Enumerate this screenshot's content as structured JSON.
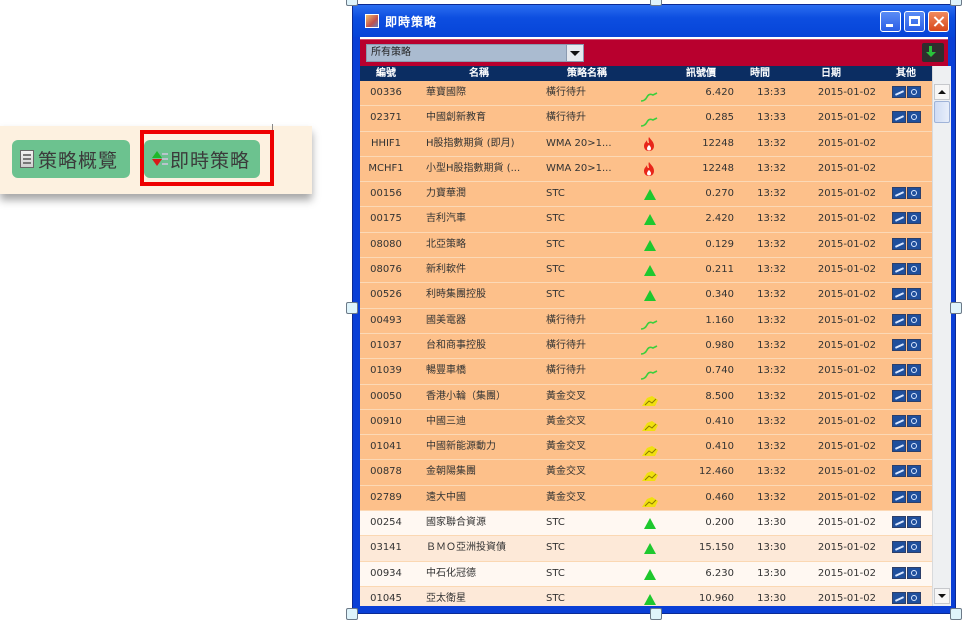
{
  "toolbar": {
    "overview_label": "策略概覽",
    "realtime_label": "即時策略"
  },
  "window": {
    "title": "即時策略",
    "controls": [
      "minimize",
      "maximize",
      "close"
    ]
  },
  "filter": {
    "selected": "所有策略",
    "export_icon": "export-icon"
  },
  "table": {
    "columns": [
      "編號",
      "名稱",
      "策略名稱",
      "",
      "訊號價",
      "時間",
      "日期",
      "其他"
    ],
    "rows": [
      {
        "code": "00336",
        "name": "華寶國際",
        "strategy": "橫行待升",
        "signal": "trend",
        "price": "6.420",
        "time": "13:33",
        "date": "2015-01-02",
        "actions": true,
        "highlight": true
      },
      {
        "code": "02371",
        "name": "中國創新教育",
        "strategy": "橫行待升",
        "signal": "trend",
        "price": "0.285",
        "time": "13:33",
        "date": "2015-01-02",
        "actions": true,
        "highlight": true
      },
      {
        "code": "HHIF1",
        "name": "H股指數期貨 (即月)",
        "strategy": "WMA 20>1...",
        "signal": "fire",
        "price": "12248",
        "time": "13:32",
        "date": "2015-01-02",
        "actions": false,
        "highlight": true
      },
      {
        "code": "MCHF1",
        "name": "小型H股指數期貨 (...",
        "strategy": "WMA 20>1...",
        "signal": "fire",
        "price": "12248",
        "time": "13:32",
        "date": "2015-01-02",
        "actions": false,
        "highlight": true
      },
      {
        "code": "00156",
        "name": "力寶華潤",
        "strategy": "STC",
        "signal": "up",
        "price": "0.270",
        "time": "13:32",
        "date": "2015-01-02",
        "actions": true,
        "highlight": true
      },
      {
        "code": "00175",
        "name": "吉利汽車",
        "strategy": "STC",
        "signal": "up",
        "price": "2.420",
        "time": "13:32",
        "date": "2015-01-02",
        "actions": true,
        "highlight": true
      },
      {
        "code": "08080",
        "name": "北亞策略",
        "strategy": "STC",
        "signal": "up",
        "price": "0.129",
        "time": "13:32",
        "date": "2015-01-02",
        "actions": true,
        "highlight": true
      },
      {
        "code": "08076",
        "name": "新利軟件",
        "strategy": "STC",
        "signal": "up",
        "price": "0.211",
        "time": "13:32",
        "date": "2015-01-02",
        "actions": true,
        "highlight": true
      },
      {
        "code": "00526",
        "name": "利時集團控股",
        "strategy": "STC",
        "signal": "up",
        "price": "0.340",
        "time": "13:32",
        "date": "2015-01-02",
        "actions": true,
        "highlight": true
      },
      {
        "code": "00493",
        "name": "國美電器",
        "strategy": "橫行待升",
        "signal": "trend",
        "price": "1.160",
        "time": "13:32",
        "date": "2015-01-02",
        "actions": true,
        "highlight": true
      },
      {
        "code": "01037",
        "name": "台和商事控股",
        "strategy": "橫行待升",
        "signal": "trend",
        "price": "0.980",
        "time": "13:32",
        "date": "2015-01-02",
        "actions": true,
        "highlight": true
      },
      {
        "code": "01039",
        "name": "暢豐車橋",
        "strategy": "橫行待升",
        "signal": "trend",
        "price": "0.740",
        "time": "13:32",
        "date": "2015-01-02",
        "actions": true,
        "highlight": true
      },
      {
        "code": "00050",
        "name": "香港小輪（集團）",
        "strategy": "黃金交叉",
        "signal": "gold",
        "price": "8.500",
        "time": "13:32",
        "date": "2015-01-02",
        "actions": true,
        "highlight": true
      },
      {
        "code": "00910",
        "name": "中國三迪",
        "strategy": "黃金交叉",
        "signal": "gold",
        "price": "0.410",
        "time": "13:32",
        "date": "2015-01-02",
        "actions": true,
        "highlight": true
      },
      {
        "code": "01041",
        "name": "中國新能源動力",
        "strategy": "黃金交叉",
        "signal": "gold",
        "price": "0.410",
        "time": "13:32",
        "date": "2015-01-02",
        "actions": true,
        "highlight": true
      },
      {
        "code": "00878",
        "name": "金朝陽集團",
        "strategy": "黃金交叉",
        "signal": "gold",
        "price": "12.460",
        "time": "13:32",
        "date": "2015-01-02",
        "actions": true,
        "highlight": true
      },
      {
        "code": "02789",
        "name": "遠大中國",
        "strategy": "黃金交叉",
        "signal": "gold",
        "price": "0.460",
        "time": "13:32",
        "date": "2015-01-02",
        "actions": true,
        "highlight": true
      },
      {
        "code": "00254",
        "name": "國家聯合資源",
        "strategy": "STC",
        "signal": "up",
        "price": "0.200",
        "time": "13:30",
        "date": "2015-01-02",
        "actions": true,
        "highlight": false
      },
      {
        "code": "03141",
        "name": "ＢＭＯ亞洲投資債",
        "strategy": "STC",
        "signal": "up",
        "price": "15.150",
        "time": "13:30",
        "date": "2015-01-02",
        "actions": true,
        "highlight": false
      },
      {
        "code": "00934",
        "name": "中石化冠德",
        "strategy": "STC",
        "signal": "up",
        "price": "6.230",
        "time": "13:30",
        "date": "2015-01-02",
        "actions": true,
        "highlight": false
      },
      {
        "code": "01045",
        "name": "亞太衛星",
        "strategy": "STC",
        "signal": "up",
        "price": "10.960",
        "time": "13:30",
        "date": "2015-01-02",
        "actions": true,
        "highlight": false
      }
    ]
  },
  "colors": {
    "signal_row": "#fdc08a",
    "header_bg": "#0b2d62",
    "filter_bar": "#b8002e",
    "up_signal": "#1ec82e",
    "highlight_box": "#ee0000"
  }
}
